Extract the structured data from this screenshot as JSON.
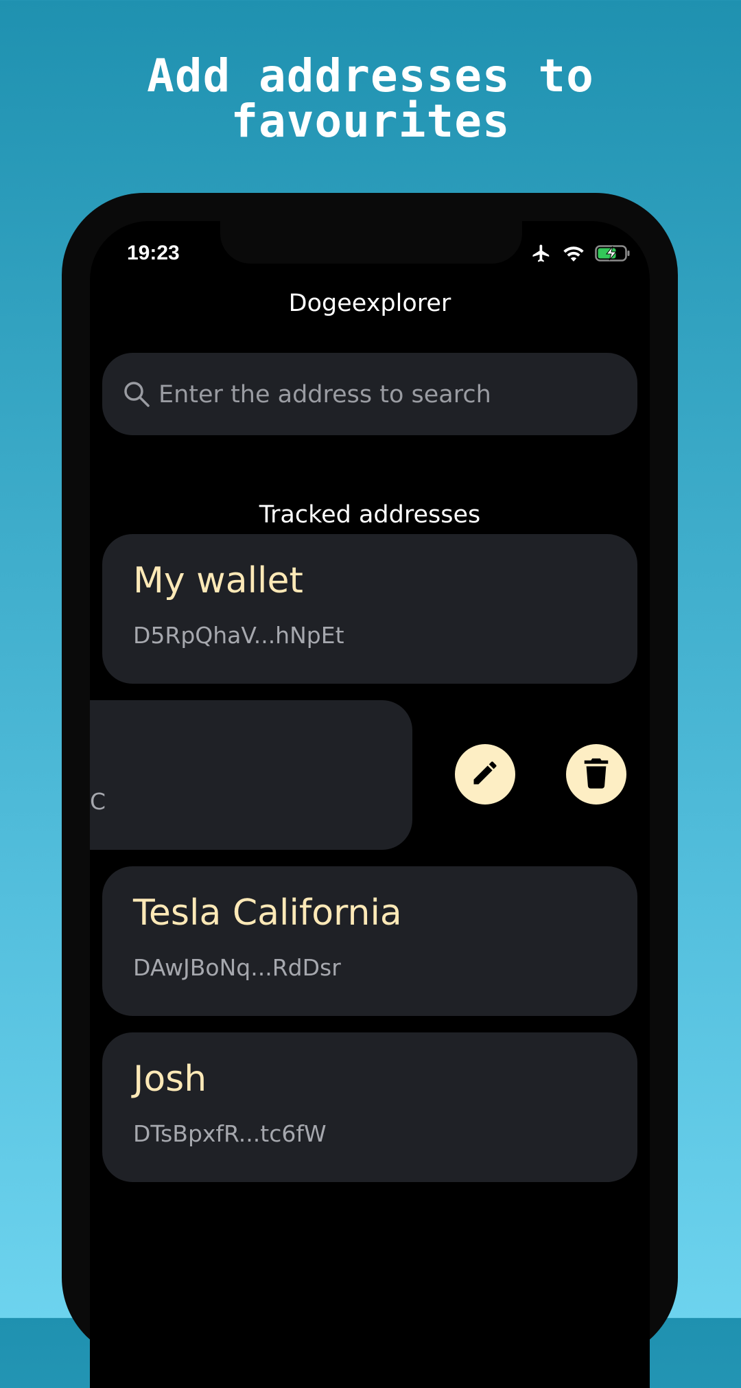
{
  "headline": {
    "line1": "Add addresses to",
    "line2": "favourites"
  },
  "status_bar": {
    "time": "19:23"
  },
  "app": {
    "title": "Dogeexplorer"
  },
  "search": {
    "placeholder": "Enter the address to search"
  },
  "section": {
    "title": "Tracked addresses"
  },
  "addresses": [
    {
      "name": "My wallet",
      "address": "D5RpQhaV...hNpEt"
    },
    {
      "name": "",
      "address": "vC"
    },
    {
      "name": "Tesla California",
      "address": "DAwJBoNq...RdDsr"
    },
    {
      "name": "Josh",
      "address": "DTsBpxfR...tc6fW"
    }
  ],
  "actions": {
    "edit_icon": "pencil-icon",
    "delete_icon": "trash-icon"
  },
  "colors": {
    "card_bg": "#1f2126",
    "name_text": "#fde9b7",
    "action_bg": "#fdeec4"
  }
}
